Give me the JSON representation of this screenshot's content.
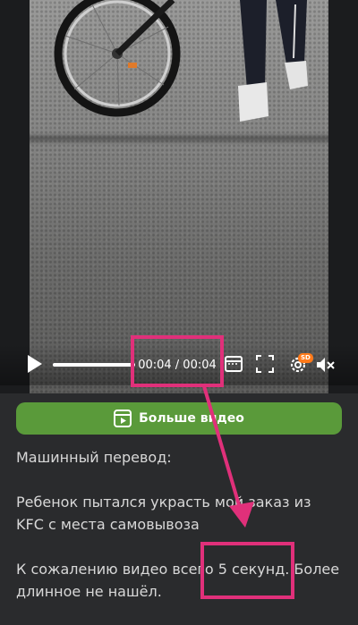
{
  "player": {
    "time_display": "00:04 / 00:04",
    "progress": 1.0,
    "quality_badge": "SD",
    "icons": [
      "play-icon",
      "picture-in-picture-icon",
      "fullscreen-icon",
      "settings-icon",
      "mute-icon"
    ]
  },
  "more_video_button": {
    "label": "Больше видео",
    "icon": "video-icon",
    "color": "#5a9a3a"
  },
  "post": {
    "translation_label": "Машинный перевод:",
    "paragraph1": "Ребенок пытался украсть мой заказ из KFC с места самовывоза",
    "paragraph2": "К сожалению видео всего 5 секунд. Более длинное не нашёл."
  },
  "annotation": {
    "color": "#e0307a"
  }
}
